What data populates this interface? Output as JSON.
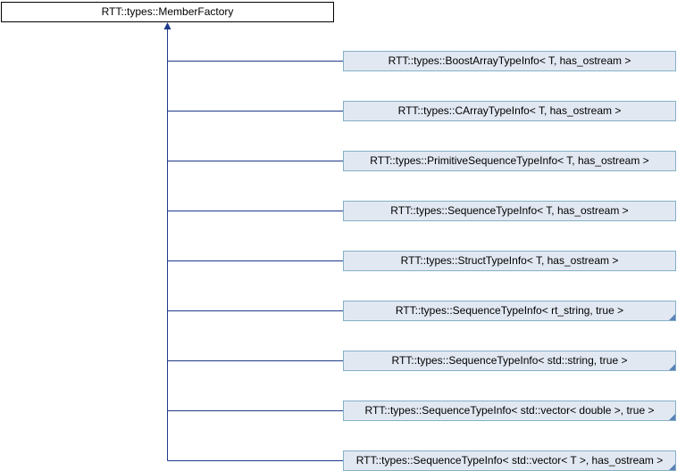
{
  "colors": {
    "edge": "#1f3a8a",
    "child_fill": "#e2e8f2",
    "child_border": "#84b0c7",
    "root_border": "#000000"
  },
  "base_class": {
    "label": "RTT::types::MemberFactory"
  },
  "derived_classes": [
    {
      "label": "RTT::types::BoostArrayTypeInfo< T, has_ostream >"
    },
    {
      "label": "RTT::types::CArrayTypeInfo< T, has_ostream >"
    },
    {
      "label": "RTT::types::PrimitiveSequenceTypeInfo< T, has_ostream >"
    },
    {
      "label": "RTT::types::SequenceTypeInfo< T, has_ostream >"
    },
    {
      "label": "RTT::types::StructTypeInfo< T, has_ostream >"
    },
    {
      "label": "RTT::types::SequenceTypeInfo< rt_string, true >"
    },
    {
      "label": "RTT::types::SequenceTypeInfo< std::string, true >"
    },
    {
      "label": "RTT::types::SequenceTypeInfo< std::vector< double >, true >"
    },
    {
      "label": "RTT::types::SequenceTypeInfo< std::vector< T >, has_ostream >"
    }
  ]
}
